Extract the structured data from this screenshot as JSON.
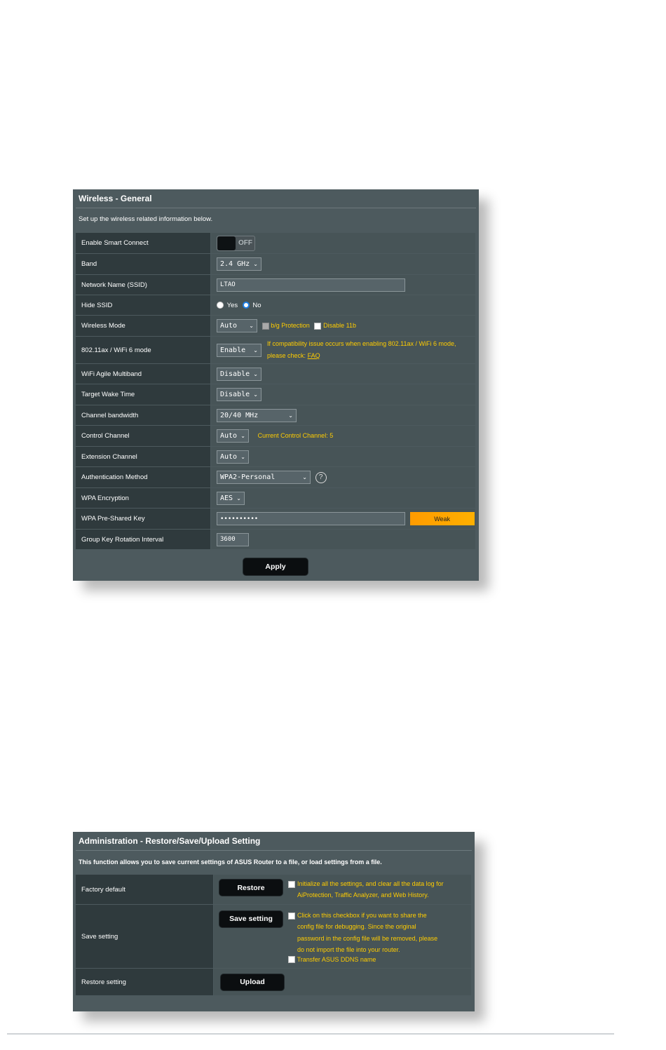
{
  "wireless": {
    "title": "Wireless - General",
    "description": "Set up the wireless related information below.",
    "rows": {
      "smart_connect": {
        "label": "Enable Smart Connect",
        "toggle": "OFF"
      },
      "band": {
        "label": "Band",
        "value": "2.4 GHz"
      },
      "ssid": {
        "label": "Network Name (SSID)",
        "value": "LTAO"
      },
      "hide_ssid": {
        "label": "Hide SSID",
        "yes": "Yes",
        "no": "No",
        "selected": "No"
      },
      "wireless_mode": {
        "label": "Wireless Mode",
        "value": "Auto",
        "bg_protection": "b/g Protection",
        "bg_protection_checked": true,
        "disable_11b": "Disable 11b",
        "disable_11b_checked": false
      },
      "wifi6_mode": {
        "label": "802.11ax / WiFi 6 mode",
        "value": "Enable",
        "note": "If compatibility issue occurs when enabling 802.11ax / WiFi 6 mode,",
        "note2": "please check:",
        "faq": "FAQ"
      },
      "agile_multiband": {
        "label": "WiFi Agile Multiband",
        "value": "Disable"
      },
      "target_wake": {
        "label": "Target Wake Time",
        "value": "Disable"
      },
      "bandwidth": {
        "label": "Channel bandwidth",
        "value": "20/40 MHz"
      },
      "control_channel": {
        "label": "Control Channel",
        "value": "Auto",
        "current": "Current Control Channel: 5"
      },
      "extension_channel": {
        "label": "Extension Channel",
        "value": "Auto"
      },
      "auth_method": {
        "label": "Authentication Method",
        "value": "WPA2-Personal"
      },
      "wpa_encryption": {
        "label": "WPA Encryption",
        "value": "AES"
      },
      "psk": {
        "label": "WPA Pre-Shared Key",
        "value": "••••••••••",
        "strength": "Weak"
      },
      "group_key": {
        "label": "Group Key Rotation Interval",
        "value": "3600"
      }
    },
    "apply": "Apply"
  },
  "admin": {
    "title": "Administration - Restore/Save/Upload Setting",
    "description": "This function allows you to save current settings of ASUS Router to a file, or load settings from a file.",
    "factory": {
      "label": "Factory default",
      "button": "Restore",
      "note1": "Initialize all the settings, and clear all the data log for",
      "note2": "AiProtection, Traffic Analyzer, and Web History."
    },
    "save": {
      "label": "Save setting",
      "button": "Save setting",
      "note1": "Click on this checkbox if you want to share the",
      "note2": "config file for debugging. Since the original",
      "note3": "password in the config file will be removed, please",
      "note4": "do not import the file into your router.",
      "ddns": "Transfer ASUS DDNS name"
    },
    "restore": {
      "label": "Restore setting",
      "button": "Upload"
    }
  },
  "colors": {
    "panel": "#4d5a5e",
    "label_bg": "#2f3a3d",
    "value_bg": "#475457",
    "accent": "#ffcc00",
    "weak": "#ff9b00"
  }
}
